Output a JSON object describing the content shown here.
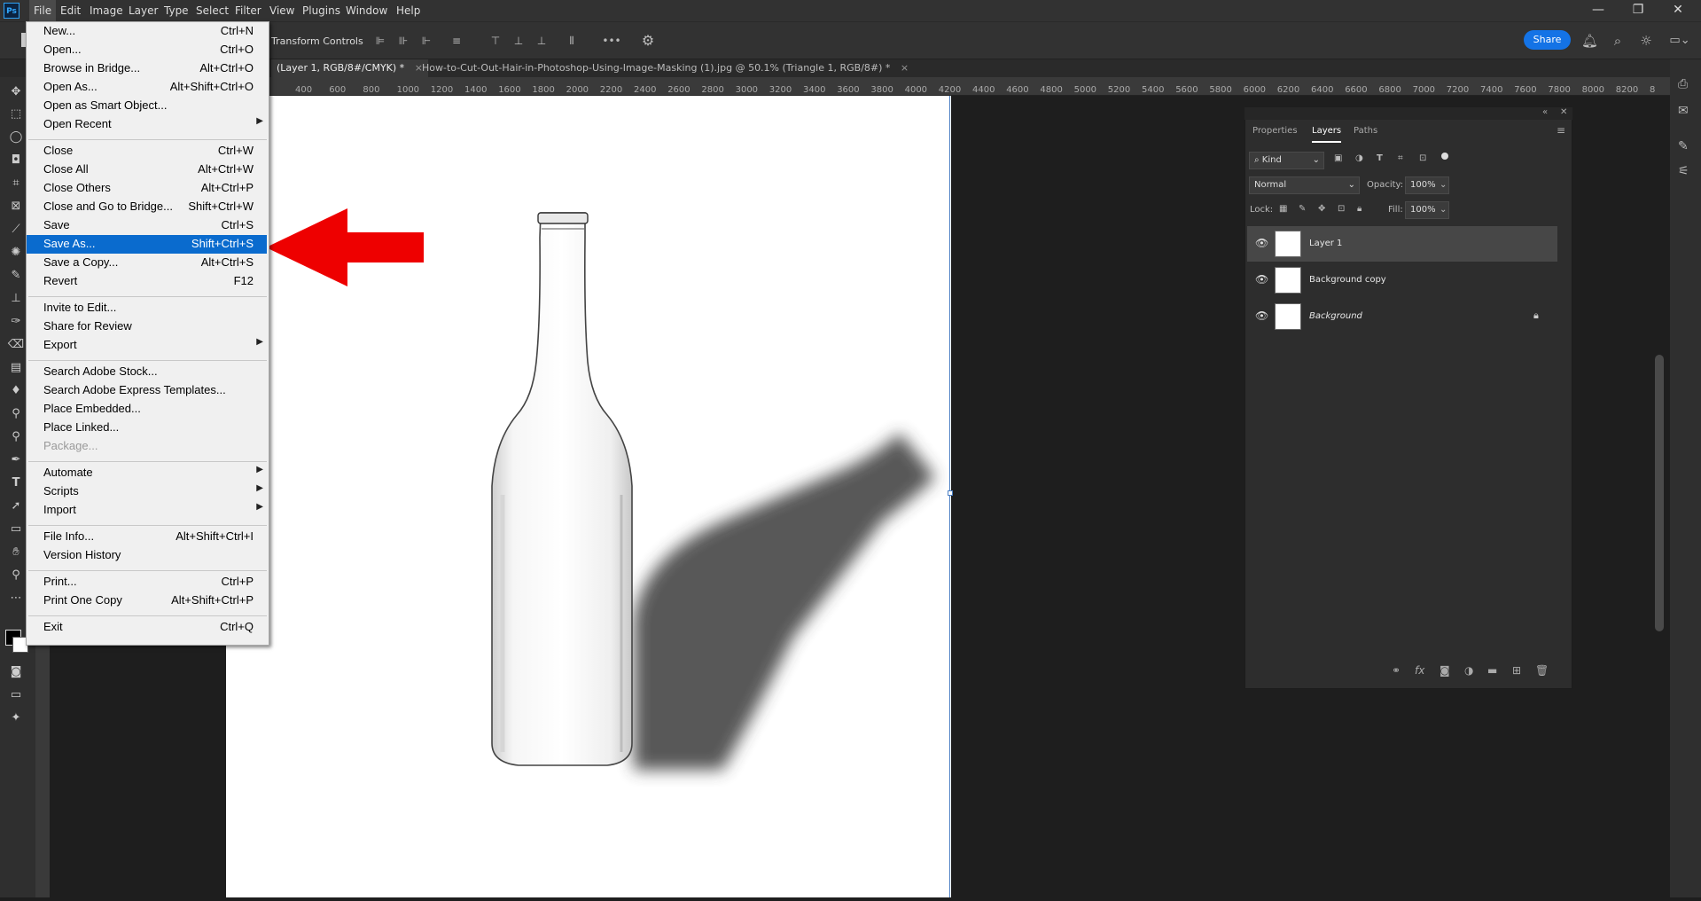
{
  "app": {
    "logo": "Ps",
    "menu": [
      "File",
      "Edit",
      "Image",
      "Layer",
      "Type",
      "Select",
      "Filter",
      "View",
      "Plugins",
      "Window",
      "Help"
    ],
    "window_controls": [
      "minimize-icon",
      "restore-icon",
      "close-icon"
    ]
  },
  "options_bar": {
    "transform_controls_label": "Transform Controls",
    "more_label": "•••",
    "share_label": "Share"
  },
  "tabs": [
    {
      "label": "(Layer 1, RGB/8#/CMYK) *"
    },
    {
      "label": "How-to-Cut-Out-Hair-in-Photoshop-Using-Image-Masking (1).jpg @ 50.1% (Triangle 1, RGB/8#) *"
    }
  ],
  "ruler_top": [
    "400",
    "600",
    "800",
    "1000",
    "1200",
    "1400",
    "1600",
    "1800",
    "2000",
    "2200",
    "2400",
    "2600",
    "2800",
    "3000",
    "3200",
    "3400",
    "3600",
    "3800",
    "4000",
    "4200",
    "4400",
    "4600",
    "4800",
    "5000",
    "5200",
    "5400",
    "5600",
    "5800",
    "6000",
    "6200",
    "6400",
    "6600",
    "6800",
    "7000",
    "7200",
    "7400",
    "7600",
    "7800",
    "8000",
    "8200",
    "8"
  ],
  "file_menu": {
    "items": [
      {
        "label": "New...",
        "shortcut": "Ctrl+N"
      },
      {
        "label": "Open...",
        "shortcut": "Ctrl+O"
      },
      {
        "label": "Browse in Bridge...",
        "shortcut": "Alt+Ctrl+O"
      },
      {
        "label": "Open As...",
        "shortcut": "Alt+Shift+Ctrl+O"
      },
      {
        "label": "Open as Smart Object...",
        "shortcut": ""
      },
      {
        "label": "Open Recent",
        "shortcut": "",
        "submenu": true
      },
      {
        "label": "Close",
        "shortcut": "Ctrl+W"
      },
      {
        "label": "Close All",
        "shortcut": "Alt+Ctrl+W"
      },
      {
        "label": "Close Others",
        "shortcut": "Alt+Ctrl+P"
      },
      {
        "label": "Close and Go to Bridge...",
        "shortcut": "Shift+Ctrl+W"
      },
      {
        "label": "Save",
        "shortcut": "Ctrl+S"
      },
      {
        "label": "Save As...",
        "shortcut": "Shift+Ctrl+S",
        "highlighted": true
      },
      {
        "label": "Save a Copy...",
        "shortcut": "Alt+Ctrl+S"
      },
      {
        "label": "Revert",
        "shortcut": "F12"
      },
      {
        "label": "Invite to Edit...",
        "shortcut": ""
      },
      {
        "label": "Share for Review",
        "shortcut": ""
      },
      {
        "label": "Export",
        "shortcut": "",
        "submenu": true
      },
      {
        "label": "Search Adobe Stock...",
        "shortcut": ""
      },
      {
        "label": "Search Adobe Express Templates...",
        "shortcut": ""
      },
      {
        "label": "Place Embedded...",
        "shortcut": ""
      },
      {
        "label": "Place Linked...",
        "shortcut": ""
      },
      {
        "label": "Package...",
        "shortcut": "",
        "disabled": true
      },
      {
        "label": "Automate",
        "shortcut": "",
        "submenu": true
      },
      {
        "label": "Scripts",
        "shortcut": "",
        "submenu": true
      },
      {
        "label": "Import",
        "shortcut": "",
        "submenu": true
      },
      {
        "label": "File Info...",
        "shortcut": "Alt+Shift+Ctrl+I"
      },
      {
        "label": "Version History",
        "shortcut": ""
      },
      {
        "label": "Print...",
        "shortcut": "Ctrl+P"
      },
      {
        "label": "Print One Copy",
        "shortcut": "Alt+Shift+Ctrl+P"
      },
      {
        "label": "Exit",
        "shortcut": "Ctrl+Q"
      }
    ]
  },
  "layers_panel": {
    "tabs": [
      "Properties",
      "Layers",
      "Paths"
    ],
    "active_tab": "Layers",
    "filter_kind": "Kind",
    "blend_mode": "Normal",
    "opacity_label": "Opacity:",
    "opacity_value": "100%",
    "lock_label": "Lock:",
    "fill_label": "Fill:",
    "fill_value": "100%",
    "layers": [
      {
        "name": "Layer 1",
        "selected": true,
        "locked": false
      },
      {
        "name": "Background copy",
        "selected": false,
        "locked": false
      },
      {
        "name": "Background",
        "selected": false,
        "locked": true
      }
    ]
  },
  "colors": {
    "accent": "#0a6bce",
    "share": "#1473e6",
    "arrow": "#ee0000"
  }
}
